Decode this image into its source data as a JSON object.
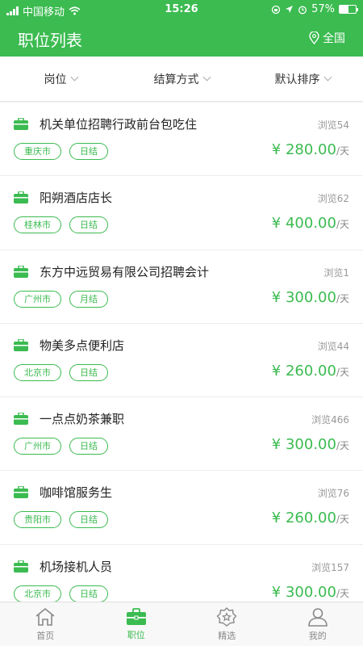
{
  "status": {
    "carrier": "中国移动",
    "time": "15:26",
    "battery": "57%",
    "battery_level": 0.57
  },
  "header": {
    "title": "职位列表",
    "location": "全国"
  },
  "filters": [
    {
      "label": "岗位"
    },
    {
      "label": "结算方式"
    },
    {
      "label": "默认排序"
    }
  ],
  "jobs": [
    {
      "title": "机关单位招聘行政前台包吃住",
      "views": "浏览54",
      "city": "重庆市",
      "settle": "日结",
      "price": "¥ 280.00",
      "unit": "/天"
    },
    {
      "title": "阳朔酒店店长",
      "views": "浏览62",
      "city": "桂林市",
      "settle": "日结",
      "price": "¥ 400.00",
      "unit": "/天"
    },
    {
      "title": "东方中远贸易有限公司招聘会计",
      "views": "浏览1",
      "city": "广州市",
      "settle": "月结",
      "price": "¥ 300.00",
      "unit": "/天"
    },
    {
      "title": "物美多点便利店",
      "views": "浏览44",
      "city": "北京市",
      "settle": "日结",
      "price": "¥ 260.00",
      "unit": "/天"
    },
    {
      "title": "一点点奶茶兼职",
      "views": "浏览466",
      "city": "广州市",
      "settle": "日结",
      "price": "¥ 300.00",
      "unit": "/天"
    },
    {
      "title": "咖啡馆服务生",
      "views": "浏览76",
      "city": "贵阳市",
      "settle": "日结",
      "price": "¥ 260.00",
      "unit": "/天"
    },
    {
      "title": "机场接机人员",
      "views": "浏览157",
      "city": "北京市",
      "settle": "日结",
      "price": "¥ 300.00",
      "unit": "/天"
    }
  ],
  "tabbar": [
    {
      "label": "首页",
      "icon": "home-icon",
      "active": false
    },
    {
      "label": "职位",
      "icon": "briefcase-icon",
      "active": true
    },
    {
      "label": "精选",
      "icon": "star-badge-icon",
      "active": false
    },
    {
      "label": "我的",
      "icon": "user-icon",
      "active": false
    }
  ],
  "colors": {
    "accent": "#3bbb50"
  }
}
